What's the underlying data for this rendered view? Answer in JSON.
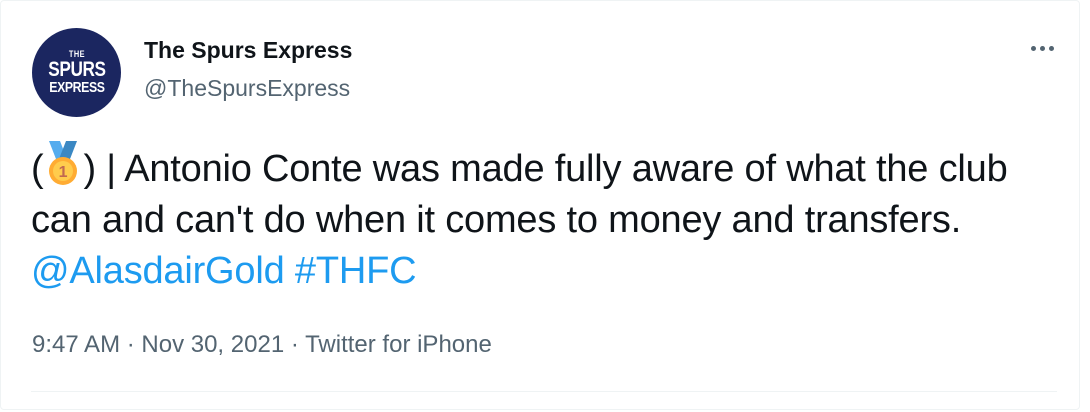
{
  "author": {
    "display_name": "The Spurs Express",
    "handle": "@TheSpursExpress",
    "avatar_text": {
      "line1": "THE",
      "line2": "SPURS",
      "line3": "EXPRESS"
    }
  },
  "menu": {
    "icon": "more-options-icon"
  },
  "tweet": {
    "open_paren": "(",
    "medal_icon": "gold-medal-icon",
    "close_paren_text": ") | Antonio Conte was made fully aware of what the club can and can't do when it comes to money and transfers. ",
    "mention": "@AlasdairGold",
    "hashtag": "#THFC"
  },
  "meta": {
    "time": "9:47 AM",
    "sep1": " · ",
    "date": "Nov 30, 2021",
    "sep2": " · ",
    "source": "Twitter for iPhone"
  },
  "colors": {
    "link": "#1d9bf0",
    "text": "#0f1419",
    "muted": "#536471",
    "avatar_bg": "#1b2660"
  }
}
